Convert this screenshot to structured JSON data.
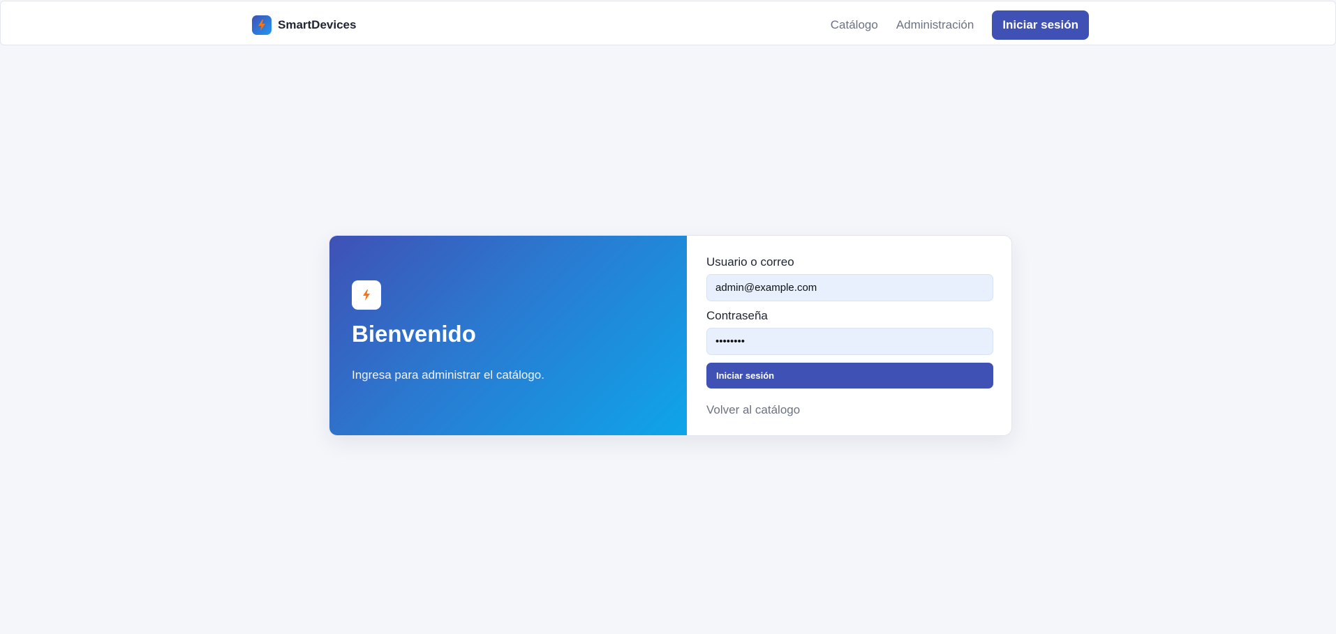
{
  "navbar": {
    "brand_name": "SmartDevices",
    "brand_icon": "lightning-bolt-icon",
    "links": [
      {
        "label": "Catálogo"
      },
      {
        "label": "Administración"
      }
    ],
    "cta_label": "Iniciar sesión"
  },
  "hero": {
    "icon": "lightning-bolt-icon",
    "title": "Bienvenido",
    "subtitle": "Ingresa para administrar el catálogo."
  },
  "login_form": {
    "username_label": "Usuario o correo",
    "username_value": "admin@example.com",
    "password_label": "Contraseña",
    "password_value": "password",
    "submit_label": "Iniciar sesión",
    "back_link_label": "Volver al catálogo"
  },
  "colors": {
    "accent": "#3f51b5",
    "bolt": "#f97316",
    "page_bg": "#f4f6fa"
  }
}
